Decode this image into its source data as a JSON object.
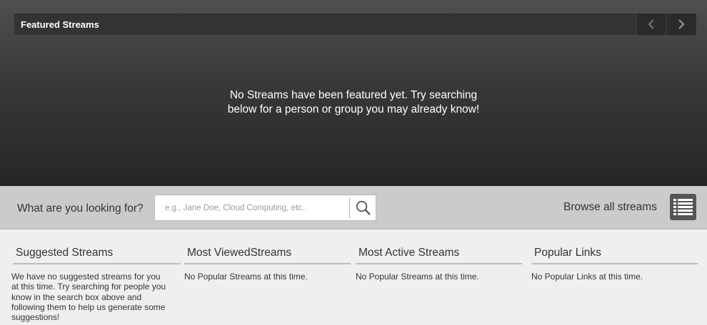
{
  "featured": {
    "title": "Featured Streams",
    "message_line1": "No Streams have been featured yet. Try searching",
    "message_line2": "below for a person or group you may already know!",
    "prev_icon": "chevron-left-icon",
    "next_icon": "chevron-right-icon"
  },
  "search": {
    "label": "What are you looking for?",
    "placeholder": "e.g., Jane Doe, Cloud Computing, etc..",
    "value": "",
    "button_icon": "search-icon",
    "browse_label": "Browse all streams",
    "browse_icon": "list-icon"
  },
  "columns": [
    {
      "title": "Suggested Streams",
      "lines": [
        "We have no suggested streams for you",
        "at this time. Try searching for people you",
        "know in the search box above and",
        "following them to help us generate some",
        "suggestions!"
      ]
    },
    {
      "title": "Most ViewedStreams",
      "lines": [
        "No Popular Streams at this time."
      ]
    },
    {
      "title": "Most Active Streams",
      "lines": [
        "No Popular Streams at this time."
      ]
    },
    {
      "title": "Popular Links",
      "lines": [
        "No Popular Links at this time."
      ]
    }
  ],
  "colors": {
    "featured_bg_top": "#4f4f4f",
    "featured_bg_bottom": "#262626",
    "search_strip_bg": "#cbcbcb",
    "content_bg": "#efefef"
  }
}
